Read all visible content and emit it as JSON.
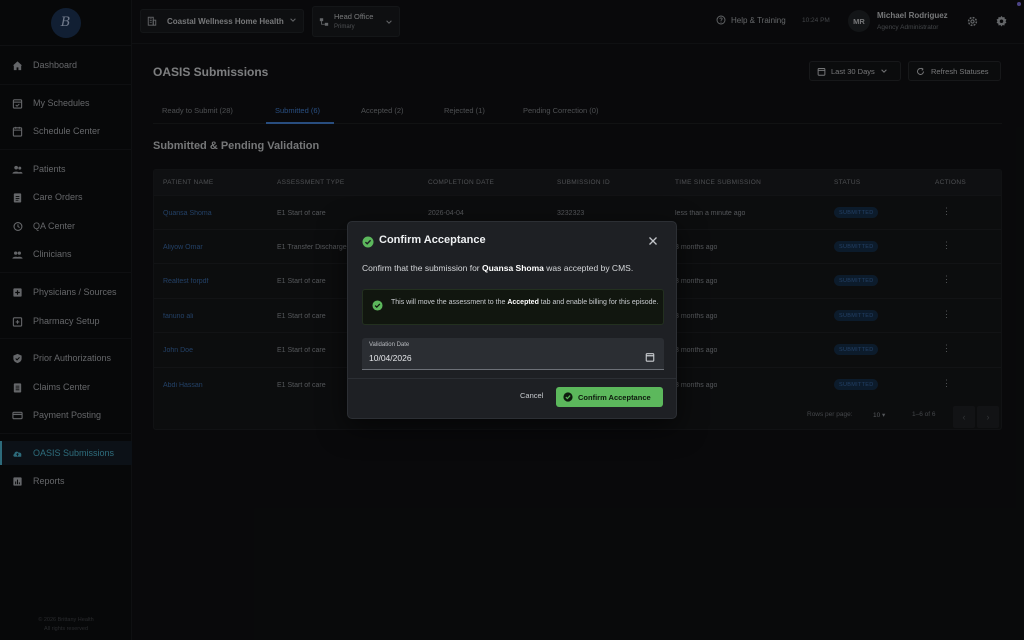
{
  "app": {
    "logo_text": "B"
  },
  "sidebar": {
    "items": [
      {
        "label": "Dashboard",
        "icon": "home-icon"
      },
      {
        "label": "My Schedules",
        "icon": "calendar-check-icon"
      },
      {
        "label": "Schedule Center",
        "icon": "calendar-icon"
      },
      {
        "label": "Patients",
        "icon": "users-icon"
      },
      {
        "label": "Care Orders",
        "icon": "clipboard-icon"
      },
      {
        "label": "QA Center",
        "icon": "history-icon"
      },
      {
        "label": "Clinicians",
        "icon": "group-icon"
      },
      {
        "label": "Physicians / Sources",
        "icon": "plus-box-icon"
      },
      {
        "label": "Pharmacy Setup",
        "icon": "pharmacy-icon"
      },
      {
        "label": "Prior Authorizations",
        "icon": "shield-check-icon"
      },
      {
        "label": "Claims Center",
        "icon": "document-icon"
      },
      {
        "label": "Payment Posting",
        "icon": "credit-card-icon"
      },
      {
        "label": "OASIS Submissions",
        "icon": "cloud-upload-icon",
        "active": true
      },
      {
        "label": "Reports",
        "icon": "chart-icon"
      }
    ],
    "footer_line1": "© 2026 Brittany Health",
    "footer_line2": "All rights reserved"
  },
  "topbar": {
    "org": "Coastal Wellness Home Health",
    "office": "Head Office",
    "office_sub": "Primary",
    "help": "Help & Training",
    "time": "10:24 PM",
    "avatar_initials": "MR",
    "user_name": "Michael Rodriguez",
    "user_role": "Agency Administrator"
  },
  "page": {
    "title": "OASIS Submissions",
    "date_range": "Last 30 Days",
    "refresh_label": "Refresh Statuses",
    "section_title": "Submitted & Pending Validation"
  },
  "tabs": [
    {
      "label": "Ready to Submit (28)"
    },
    {
      "label": "Submitted (6)",
      "active": true
    },
    {
      "label": "Accepted (2)"
    },
    {
      "label": "Rejected (1)"
    },
    {
      "label": "Pending Correction (0)"
    }
  ],
  "table": {
    "headers": [
      "PATIENT NAME",
      "ASSESSMENT TYPE",
      "COMPLETION DATE",
      "SUBMISSION ID",
      "TIME SINCE SUBMISSION",
      "STATUS",
      "ACTIONS"
    ],
    "rows": [
      {
        "patient": "Quansa Shoma",
        "type": "E1 Start of care",
        "date": "2026-04-04",
        "sub_id": "3232323",
        "since": "less than a minute ago",
        "status": "SUBMITTED"
      },
      {
        "patient": "Aliyow Omar",
        "type": "E1 Transfer Discharge",
        "date": "",
        "sub_id": "",
        "since": "3 months ago",
        "status": "SUBMITTED"
      },
      {
        "patient": "Realtest forpdf",
        "type": "E1 Start of care",
        "date": "",
        "sub_id": "",
        "since": "3 months ago",
        "status": "SUBMITTED"
      },
      {
        "patient": "fanuno ali",
        "type": "E1 Start of care",
        "date": "",
        "sub_id": "",
        "since": "3 months ago",
        "status": "SUBMITTED"
      },
      {
        "patient": "John Doe",
        "type": "E1 Start of care",
        "date": "",
        "sub_id": "",
        "since": "3 months ago",
        "status": "SUBMITTED"
      },
      {
        "patient": "Abdi Hassan",
        "type": "E1 Start of care",
        "date": "",
        "sub_id": "",
        "since": "3 months ago",
        "status": "SUBMITTED"
      }
    ],
    "rows_per_page_label": "Rows per page:",
    "rows_per_page": "10",
    "range": "1–6 of 6"
  },
  "modal": {
    "title": "Confirm Acceptance",
    "msg_prefix": "Confirm that the submission for ",
    "msg_patient": "Quansa Shoma",
    "msg_suffix": " was accepted by CMS.",
    "info_prefix": "This will move the assessment to the ",
    "info_bold": "Accepted",
    "info_suffix": " tab and enable billing for this episode.",
    "date_label": "Validation Date",
    "date_value": "10/04/2026",
    "cancel": "Cancel",
    "confirm": "Confirm Acceptance"
  },
  "colors": {
    "accent": "#53c3e0",
    "link": "#3f74b8",
    "success": "#5cb85c"
  }
}
